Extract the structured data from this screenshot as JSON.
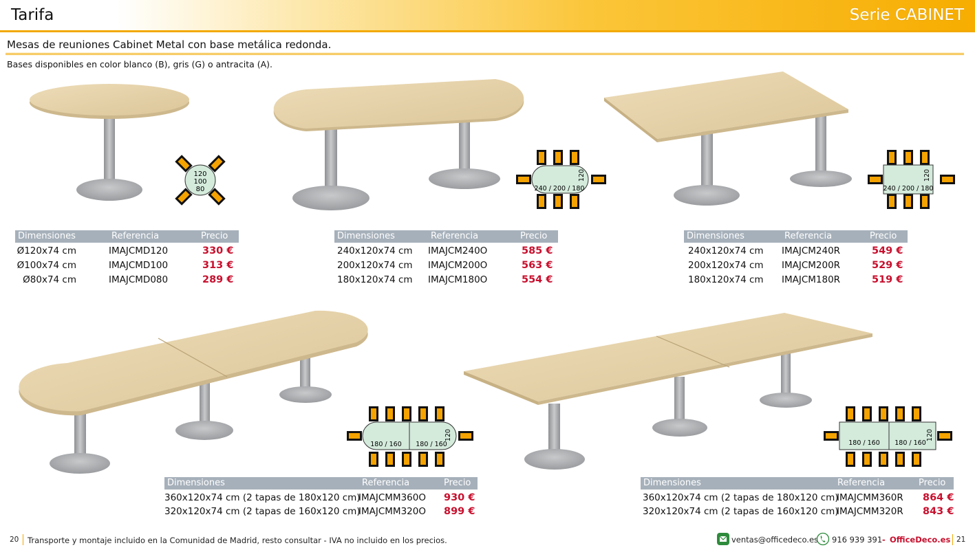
{
  "header": {
    "title": "Tarifa",
    "series": "Serie CABINET"
  },
  "intro": {
    "heading": "Mesas de reuniones Cabinet Metal con base metálica redonda.",
    "bases": "Bases disponibles en color blanco (B), gris (G) o antracita (A)."
  },
  "table_headers": {
    "dim": "Dimensiones",
    "ref": "Referencia",
    "price": "Precio"
  },
  "diagrams": {
    "round": [
      "120",
      "100",
      "80"
    ],
    "oval": {
      "main": "240 / 200 / 180",
      "side": "120"
    },
    "rect": {
      "main": "240 / 200 / 180",
      "side": "120"
    },
    "big_oval": {
      "left": "180 / 160",
      "right": "180 / 160",
      "side": "120"
    },
    "big_rect": {
      "left": "180 / 160",
      "right": "180 / 160",
      "side": "120"
    }
  },
  "tables": {
    "round": [
      {
        "dim": "Ø120x74 cm",
        "ref": "IMAJCMD120",
        "price": "330 €"
      },
      {
        "dim": "Ø100x74 cm",
        "ref": "IMAJCMD100",
        "price": "313 €"
      },
      {
        "dim": "Ø80x74 cm",
        "ref": "IMAJCMD080",
        "price": "289 €"
      }
    ],
    "oval": [
      {
        "dim": "240x120x74 cm",
        "ref": "IMAJCM240O",
        "price": "585 €"
      },
      {
        "dim": "200x120x74 cm",
        "ref": "IMAJCM200O",
        "price": "563 €"
      },
      {
        "dim": "180x120x74 cm",
        "ref": "IMAJCM180O",
        "price": "554 €"
      }
    ],
    "rect": [
      {
        "dim": "240x120x74 cm",
        "ref": "IMAJCM240R",
        "price": "549 €"
      },
      {
        "dim": "200x120x74 cm",
        "ref": "IMAJCM200R",
        "price": "529 €"
      },
      {
        "dim": "180x120x74 cm",
        "ref": "IMAJCM180R",
        "price": "519 €"
      }
    ],
    "big_oval": [
      {
        "dim": "360x120x74 cm (2 tapas de 180x120 cm)",
        "ref": "IMAJCMM360O",
        "price": "930 €"
      },
      {
        "dim": "320x120x74 cm (2 tapas de 160x120 cm)",
        "ref": "IMAJCMM320O",
        "price": "899 €"
      }
    ],
    "big_rect": [
      {
        "dim": "360x120x74 cm (2 tapas de 180x120 cm)",
        "ref": "IMAJCMM360R",
        "price": "864 €"
      },
      {
        "dim": "320x120x74 cm (2 tapas de 160x120 cm)",
        "ref": "IMAJCMM320R",
        "price": "843 €"
      }
    ]
  },
  "footer": {
    "page_left": "20",
    "note": "Transporte y montaje incluido en la Comunidad de Madrid, resto consultar - IVA no incluido en los precios.",
    "email": "ventas@officedeco.es",
    "phone": "916 939 391",
    "dash": "-",
    "brand": "OfficeDeco.es",
    "page_right": "21"
  },
  "colors": {
    "accent": "#f7ad00",
    "price": "#c8102e",
    "table_header": "#a6b0ba",
    "wood": "#e6d3ad",
    "metal": "#a9abae",
    "chair": "#f5a300",
    "diagram_fill": "#d4ebdc"
  }
}
